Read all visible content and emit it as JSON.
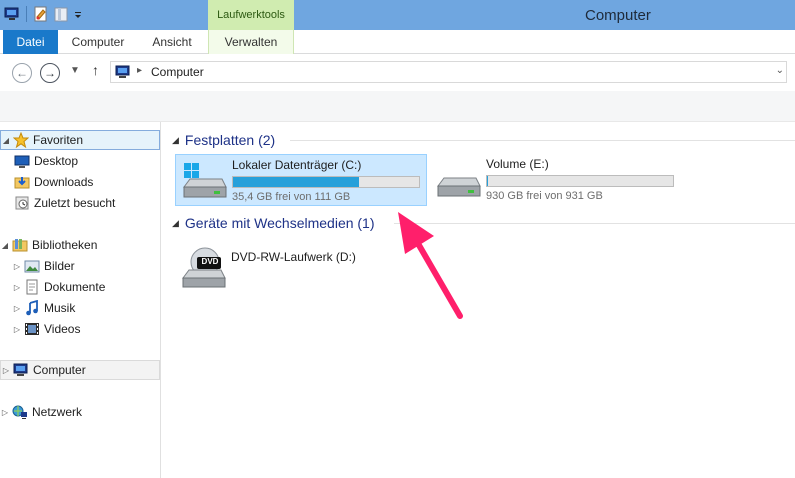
{
  "window": {
    "title": "Computer"
  },
  "ribbon": {
    "context_group": "Laufwerktools",
    "tabs": [
      {
        "label": "Datei"
      },
      {
        "label": "Computer"
      },
      {
        "label": "Ansicht"
      },
      {
        "label": "Verwalten"
      }
    ]
  },
  "address": {
    "path": "Computer"
  },
  "nav": {
    "favorites": {
      "label": "Favoriten",
      "items": [
        {
          "label": "Desktop"
        },
        {
          "label": "Downloads"
        },
        {
          "label": "Zuletzt besucht"
        }
      ]
    },
    "libraries": {
      "label": "Bibliotheken",
      "items": [
        {
          "label": "Bilder"
        },
        {
          "label": "Dokumente"
        },
        {
          "label": "Musik"
        },
        {
          "label": "Videos"
        }
      ]
    },
    "computer": {
      "label": "Computer"
    },
    "network": {
      "label": "Netzwerk"
    }
  },
  "content": {
    "groups": [
      {
        "title": "Festplatten (2)",
        "drives": [
          {
            "name": "Lokaler Datenträger (C:)",
            "free_text": "35,4 GB frei von 111 GB",
            "used_fraction": 0.68
          },
          {
            "name": "Volume (E:)",
            "free_text": "930 GB frei von 931 GB",
            "used_fraction": 0.001
          }
        ]
      },
      {
        "title": "Geräte mit Wechselmedien (1)",
        "devices": [
          {
            "name": "DVD-RW-Laufwerk (D:)",
            "icon_label": "DVD"
          }
        ]
      }
    ]
  },
  "colors": {
    "accent": "#1979ca",
    "bar": "#26a0da",
    "annotation_arrow": "#ff1f6b"
  }
}
